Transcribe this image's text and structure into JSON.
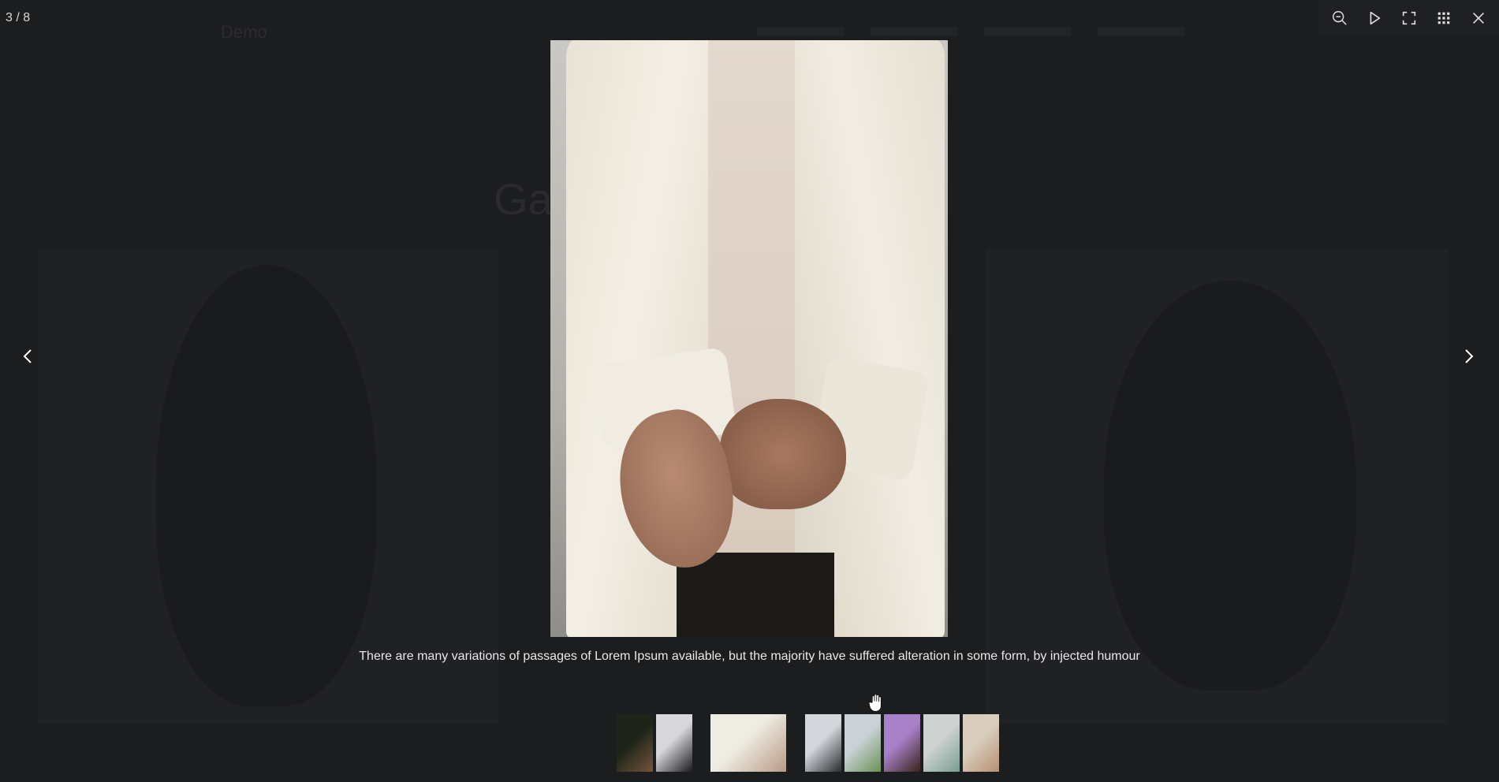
{
  "counter": "3 / 8",
  "toolbar": {
    "zoom_out": "zoom-out-icon",
    "slideshow": "play-icon",
    "fullscreen": "fullscreen-icon",
    "thumbnails": "grid-icon",
    "close": "close-icon"
  },
  "background_page": {
    "logo": "Demo",
    "heading": "Gal"
  },
  "caption": "There are many variations of passages of Lorem Ipsum available, but the majority have suffered alteration in some form, by injected humour",
  "thumbnails": [
    {
      "id": 1,
      "colors": [
        "#1d2418",
        "#7a5a3c"
      ]
    },
    {
      "id": 2,
      "colors": [
        "#e8e8ea",
        "#1a1a1c"
      ]
    },
    {
      "id": 3,
      "colors": [
        "#efece3",
        "#b89a86"
      ],
      "active": true
    },
    {
      "id": 4,
      "colors": [
        "#e4e8ee",
        "#2a2c30"
      ]
    },
    {
      "id": 5,
      "colors": [
        "#d9e2e8",
        "#6f9c5a"
      ]
    },
    {
      "id": 6,
      "colors": [
        "#b58ad8",
        "#3a241c"
      ]
    },
    {
      "id": 7,
      "colors": [
        "#dde3e2",
        "#7fa99a"
      ]
    },
    {
      "id": 8,
      "colors": [
        "#e9dccb",
        "#c79a78"
      ]
    }
  ]
}
